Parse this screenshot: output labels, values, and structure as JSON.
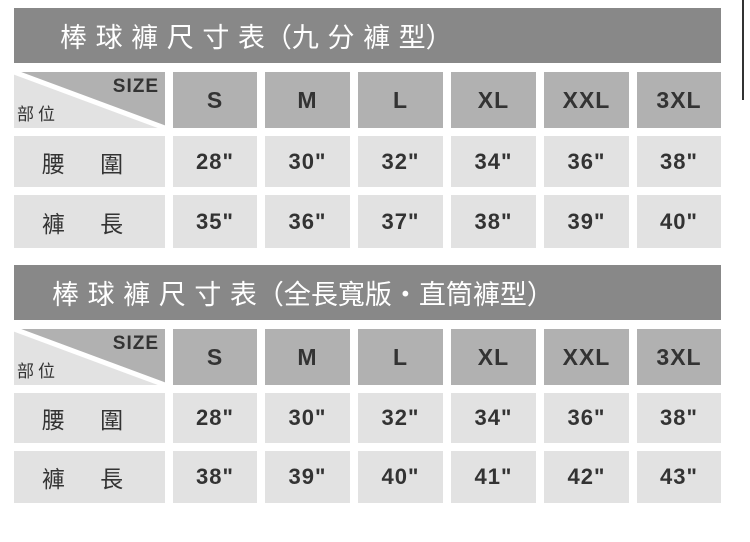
{
  "tables": [
    {
      "title": "棒 球 褲 尺 寸 表（九 分 褲 型）",
      "size_header": "SIZE",
      "part_header": "部位",
      "sizes": [
        "S",
        "M",
        "L",
        "XL",
        "XXL",
        "3XL"
      ],
      "rows": [
        {
          "label": "腰 圍",
          "values": [
            "28\"",
            "30\"",
            "32\"",
            "34\"",
            "36\"",
            "38\""
          ]
        },
        {
          "label": "褲 長",
          "values": [
            "35\"",
            "36\"",
            "37\"",
            "38\"",
            "39\"",
            "40\""
          ]
        }
      ]
    },
    {
      "title": "棒 球 褲 尺 寸 表（全長寬版・直筒褲型）",
      "size_header": "SIZE",
      "part_header": "部位",
      "sizes": [
        "S",
        "M",
        "L",
        "XL",
        "XXL",
        "3XL"
      ],
      "rows": [
        {
          "label": "腰 圍",
          "values": [
            "28\"",
            "30\"",
            "32\"",
            "34\"",
            "36\"",
            "38\""
          ]
        },
        {
          "label": "褲 長",
          "values": [
            "38\"",
            "39\"",
            "40\"",
            "41\"",
            "42\"",
            "43\""
          ]
        }
      ]
    }
  ],
  "colors": {
    "title_bg": "#888888",
    "header_bg": "#b1b1b1",
    "cell_bg": "#e2e2e2",
    "text": "#333333"
  }
}
